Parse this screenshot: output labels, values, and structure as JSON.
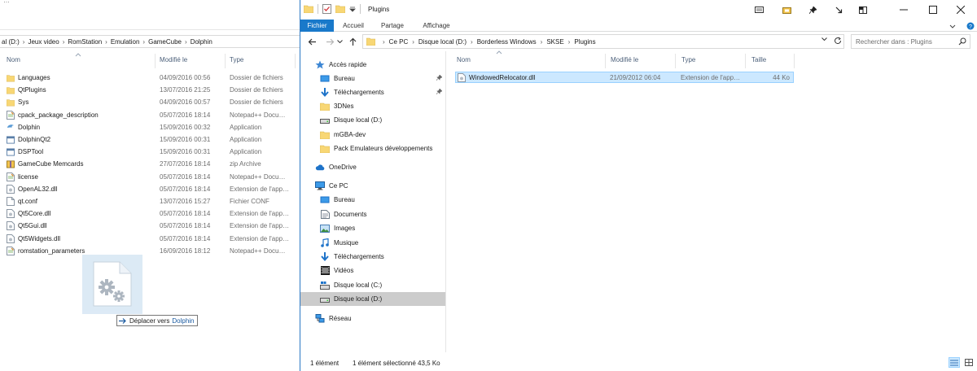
{
  "back_window": {
    "top_clipped_text": "…",
    "breadcrumb": [
      "al (D:)",
      "Jeux video",
      "RomStation",
      "Emulation",
      "GameCube",
      "Dolphin"
    ],
    "columns": {
      "name": "Nom",
      "modified": "Modifié le",
      "type": "Type"
    },
    "rows": [
      {
        "name": "Languages",
        "modified": "04/09/2016 00:56",
        "type": "Dossier de fichiers",
        "icon": "folder-icon"
      },
      {
        "name": "QtPlugins",
        "modified": "13/07/2016 21:25",
        "type": "Dossier de fichiers",
        "icon": "folder-icon"
      },
      {
        "name": "Sys",
        "modified": "04/09/2016 00:57",
        "type": "Dossier de fichiers",
        "icon": "folder-icon"
      },
      {
        "name": "cpack_package_description",
        "modified": "05/07/2016 18:14",
        "type": "Notepad++ Docu…",
        "icon": "notepad-document-icon"
      },
      {
        "name": "Dolphin",
        "modified": "15/09/2016 00:32",
        "type": "Application",
        "icon": "dolphin-app-icon"
      },
      {
        "name": "DolphinQt2",
        "modified": "15/09/2016 00:31",
        "type": "Application",
        "icon": "application-icon"
      },
      {
        "name": "DSPTool",
        "modified": "15/09/2016 00:31",
        "type": "Application",
        "icon": "application-icon"
      },
      {
        "name": "GameCube Memcards",
        "modified": "27/07/2016 18:14",
        "type": "zip Archive",
        "icon": "zip-archive-icon"
      },
      {
        "name": "license",
        "modified": "05/07/2016 18:14",
        "type": "Notepad++ Docu…",
        "icon": "notepad-document-icon"
      },
      {
        "name": "OpenAL32.dll",
        "modified": "05/07/2016 18:14",
        "type": "Extension de l'app…",
        "icon": "dll-file-icon"
      },
      {
        "name": "qt.conf",
        "modified": "13/07/2016 15:27",
        "type": "Fichier CONF",
        "icon": "blank-file-icon"
      },
      {
        "name": "Qt5Core.dll",
        "modified": "05/07/2016 18:14",
        "type": "Extension de l'app…",
        "icon": "dll-file-icon"
      },
      {
        "name": "Qt5Gui.dll",
        "modified": "05/07/2016 18:14",
        "type": "Extension de l'app…",
        "icon": "dll-file-icon"
      },
      {
        "name": "Qt5Widgets.dll",
        "modified": "05/07/2016 18:14",
        "type": "Extension de l'app…",
        "icon": "dll-file-icon"
      },
      {
        "name": "romstation_parameters",
        "modified": "16/09/2016 18:12",
        "type": "Notepad++ Docu…",
        "icon": "notepad-document-icon"
      }
    ]
  },
  "drag": {
    "tooltip_action": "Déplacer vers",
    "tooltip_target": "Dolphin"
  },
  "front_window": {
    "title": "Plugins",
    "ribbon_tabs": [
      "Fichier",
      "Accueil",
      "Partage",
      "Affichage"
    ],
    "address": [
      "Ce PC",
      "Disque local (D:)",
      "Borderless Windows",
      "SKSE",
      "Plugins"
    ],
    "search_placeholder": "Rechercher dans : Plugins",
    "nav": [
      {
        "label": "Accès rapide",
        "icon": "star-icon",
        "pinned": false
      },
      {
        "label": "Bureau",
        "icon": "desktop-icon",
        "pinned": true
      },
      {
        "label": "Téléchargements",
        "icon": "download-arrow-icon",
        "pinned": true
      },
      {
        "label": "3DNes",
        "icon": "folder-icon",
        "pinned": false
      },
      {
        "label": "Disque local (D:)",
        "icon": "drive-icon",
        "pinned": false
      },
      {
        "label": "mGBA-dev",
        "icon": "folder-icon",
        "pinned": false
      },
      {
        "label": "Pack Emulateurs développements",
        "icon": "folder-icon",
        "pinned": false
      },
      {
        "label": "OneDrive",
        "icon": "cloud-icon",
        "pinned": false
      },
      {
        "label": "Ce PC",
        "icon": "computer-icon",
        "pinned": false
      },
      {
        "label": "Bureau",
        "icon": "desktop-icon",
        "pinned": false
      },
      {
        "label": "Documents",
        "icon": "documents-icon",
        "pinned": false
      },
      {
        "label": "Images",
        "icon": "pictures-icon",
        "pinned": false
      },
      {
        "label": "Musique",
        "icon": "music-icon",
        "pinned": false
      },
      {
        "label": "Téléchargements",
        "icon": "download-arrow-icon",
        "pinned": false
      },
      {
        "label": "Vidéos",
        "icon": "videos-icon",
        "pinned": false
      },
      {
        "label": "Disque local (C:)",
        "icon": "windows-drive-icon",
        "pinned": false
      },
      {
        "label": "Disque local (D:)",
        "icon": "drive-icon",
        "pinned": false
      },
      {
        "label": "Réseau",
        "icon": "network-icon",
        "pinned": false
      }
    ],
    "columns": {
      "name": "Nom",
      "modified": "Modifié le",
      "type": "Type",
      "size": "Taille"
    },
    "files": [
      {
        "name": "WindowedRelocator.dll",
        "modified": "21/09/2012 06:04",
        "type": "Extension de l'app…",
        "size": "44 Ko",
        "icon": "dll-file-icon"
      }
    ],
    "status": {
      "count": "1 élément",
      "selection": "1 élément sélectionné 43,5 Ko"
    }
  },
  "colors": {
    "accent": "#1979ca",
    "folder": "#f8d775",
    "selection": "#cce8ff",
    "selection_border": "#99d1ff",
    "nav_selected": "#cccccc"
  }
}
